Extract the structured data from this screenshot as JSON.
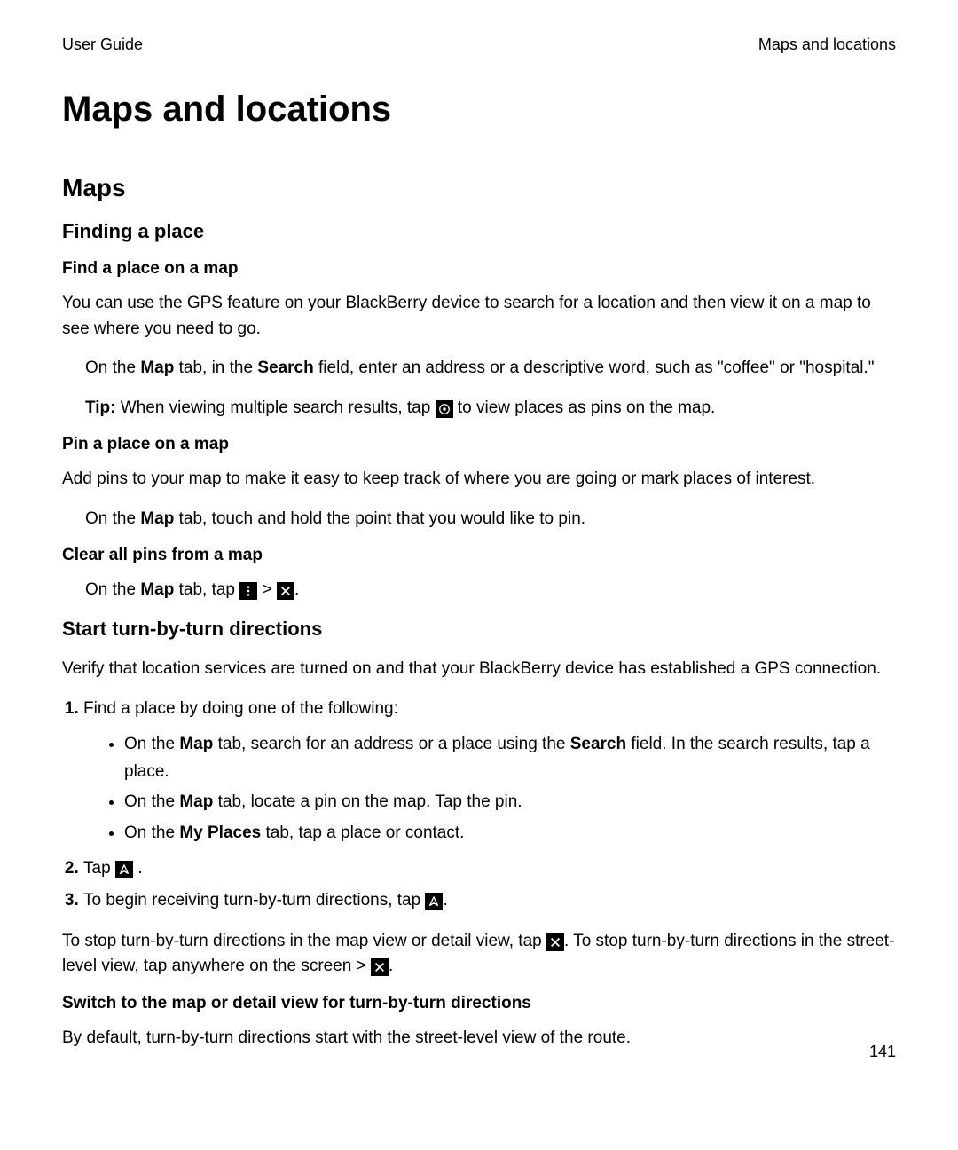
{
  "header": {
    "left": "User Guide",
    "right": "Maps and locations"
  },
  "title": "Maps and locations",
  "section_maps": {
    "heading": "Maps",
    "finding": {
      "heading": "Finding a place",
      "find_on_map": {
        "heading": "Find a place on a map",
        "para": "You can use the GPS feature on your BlackBerry device to search for a location and then view it on a map to see where you need to go.",
        "step_pre": "On the ",
        "step_map": "Map",
        "step_mid1": " tab, in the ",
        "step_search": "Search",
        "step_post": " field, enter an address or a descriptive word, such as \"coffee\" or \"hospital.\"",
        "tip_label": "Tip:",
        "tip_pre": " When viewing multiple search results, tap ",
        "tip_post": " to view places as pins on the map."
      },
      "pin": {
        "heading": "Pin a place on a map",
        "para": "Add pins to your map to make it easy to keep track of where you are going or mark places of interest.",
        "step_pre": "On the ",
        "step_map": "Map",
        "step_post": " tab, touch and hold the point that you would like to pin."
      },
      "clear": {
        "heading": "Clear all pins from a map",
        "step_pre": "On the ",
        "step_map": "Map",
        "step_mid": " tab, tap ",
        "sep": " > ",
        "step_end": "."
      }
    },
    "directions": {
      "heading": "Start turn-by-turn directions",
      "para": "Verify that location services are turned on and that your BlackBerry device has established a GPS connection.",
      "step1_intro": "Find a place by doing one of the following:",
      "bullet1_pre": "On the ",
      "bullet1_map": "Map",
      "bullet1_mid": " tab, search for an address or a place using the ",
      "bullet1_search": "Search",
      "bullet1_post": " field. In the search results, tap a place.",
      "bullet2_pre": "On the ",
      "bullet2_map": "Map",
      "bullet2_post": " tab, locate a pin on the map. Tap the pin.",
      "bullet3_pre": "On the ",
      "bullet3_myplaces": "My Places",
      "bullet3_post": " tab, tap a place or contact.",
      "step2_pre": "Tap ",
      "step2_post": " .",
      "step3_pre": "To begin receiving turn-by-turn directions, tap ",
      "step3_post": ".",
      "stop_pre": "To stop turn-by-turn directions in the map view or detail view, tap ",
      "stop_mid": ". To stop turn-by-turn directions in the street-level view, tap anywhere on the screen > ",
      "stop_post": ".",
      "switch": {
        "heading": "Switch to the map or detail view for turn-by-turn directions",
        "para": "By default, turn-by-turn directions start with the street-level view of the route."
      }
    }
  },
  "page_number": "141"
}
